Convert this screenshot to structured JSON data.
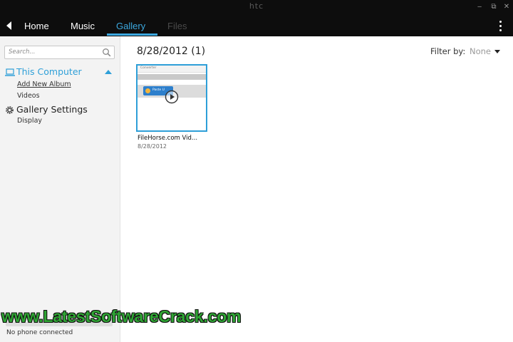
{
  "app": {
    "brand": "htc"
  },
  "window_controls": {
    "minimize": "‒",
    "restore": "⧉",
    "close": "✕"
  },
  "tabs": [
    {
      "label": "Home"
    },
    {
      "label": "Music"
    },
    {
      "label": "Gallery",
      "active": true
    },
    {
      "label": "Files",
      "disabled": true
    }
  ],
  "colors": {
    "accent": "#3ca8df",
    "topbar": "#0d0d0d",
    "sidebar": "#f3f3f3",
    "watermark": "#2fa534"
  },
  "sidebar": {
    "search_placeholder": "Search...",
    "this_computer": "This Computer",
    "add_new_album": "Add New Album",
    "videos": "Videos",
    "gallery_settings": "Gallery Settings",
    "display": "Display",
    "status": "No phone connected"
  },
  "main": {
    "date_heading": "8/28/2012 (1)",
    "filter_label": "Filter by:",
    "filter_value": "None",
    "items": [
      {
        "name": "FileHorse.com Vid...",
        "date": "8/28/2012",
        "thumbnail_title": "Converter",
        "thumbnail_button": "Paste U"
      }
    ]
  },
  "watermark": "www.LatestSoftwareCrack.com"
}
